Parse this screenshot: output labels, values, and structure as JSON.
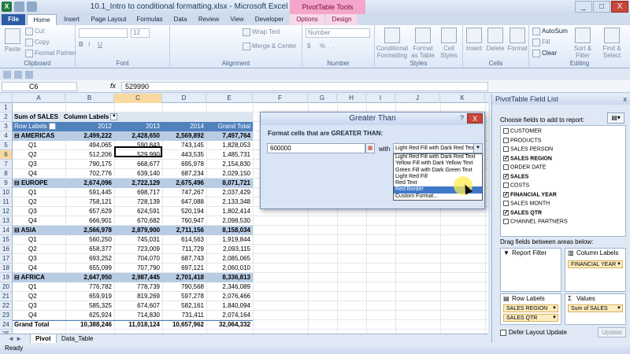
{
  "window": {
    "title": "10.1_Intro to conditional formatting.xlsx - Microsoft Excel",
    "contextual_tab_group": "PivotTable Tools",
    "controls": [
      "_",
      "□",
      "X"
    ]
  },
  "ribbon_tabs": [
    "File",
    "Home",
    "Insert",
    "Page Layout",
    "Formulas",
    "Data",
    "Review",
    "View",
    "Developer",
    "Options",
    "Design"
  ],
  "ribbon": {
    "clipboard": {
      "label": "Clipboard",
      "paste": "Paste",
      "cut": "Cut",
      "copy": "Copy",
      "format_painter": "Format Painter"
    },
    "font": {
      "label": "Font",
      "size": "12",
      "bold": "B",
      "italic": "I",
      "underline": "U"
    },
    "alignment": {
      "label": "Alignment",
      "wrap": "Wrap Text",
      "merge": "Merge & Center"
    },
    "number": {
      "label": "Number",
      "format": "Number",
      "currency": "$",
      "percent": "%",
      "comma": ","
    },
    "styles": {
      "label": "Styles",
      "conditional": "Conditional Formatting",
      "format_table": "Format as Table",
      "cell_styles": "Cell Styles"
    },
    "cells": {
      "label": "Cells",
      "insert": "Insert",
      "delete": "Delete",
      "format": "Format"
    },
    "editing": {
      "label": "Editing",
      "autosum": "AutoSum",
      "fill": "Fill",
      "clear": "Clear",
      "sort": "Sort & Filter",
      "find": "Find & Select"
    }
  },
  "formula_bar": {
    "name_box": "C6",
    "fx": "fx",
    "value": "529990"
  },
  "columns": [
    "A",
    "B",
    "C",
    "D",
    "E",
    "F",
    "G",
    "H",
    "I",
    "J",
    "K"
  ],
  "rows": [
    "1",
    "2",
    "3",
    "4",
    "5",
    "6",
    "7",
    "8",
    "9",
    "10",
    "11",
    "12",
    "13",
    "14",
    "15",
    "16",
    "17",
    "18",
    "19",
    "20",
    "21",
    "22",
    "23",
    "24",
    "25"
  ],
  "pivot": {
    "sum_label": "Sum of SALES",
    "col_labels": "Column Labels",
    "row_labels": "Row Labels",
    "years": [
      "2012",
      "2013",
      "2014",
      "Grand Total"
    ],
    "regions": [
      {
        "name": "AMERICAS",
        "values": [
          "2,499,222",
          "2,428,650",
          "2,569,892",
          "7,497,764"
        ],
        "quarters": [
          {
            "q": "Q1",
            "values": [
              "494,065",
              "590,843",
              "743,145",
              "1,828,053"
            ]
          },
          {
            "q": "Q2",
            "values": [
              "512,206",
              "529,990",
              "443,535",
              "1,485,731"
            ]
          },
          {
            "q": "Q3",
            "values": [
              "790,175",
              "668,677",
              "695,978",
              "2,154,830"
            ]
          },
          {
            "q": "Q4",
            "values": [
              "702,776",
              "639,140",
              "687,234",
              "2,029,150"
            ]
          }
        ]
      },
      {
        "name": "EUROPE",
        "values": [
          "2,674,096",
          "2,722,129",
          "2,675,496",
          "8,071,721"
        ],
        "quarters": [
          {
            "q": "Q1",
            "values": [
              "591,445",
              "698,717",
              "747,267",
              "2,037,429"
            ]
          },
          {
            "q": "Q2",
            "values": [
              "758,121",
              "728,139",
              "647,088",
              "2,133,348"
            ]
          },
          {
            "q": "Q3",
            "values": [
              "657,629",
              "624,591",
              "520,194",
              "1,802,414"
            ]
          },
          {
            "q": "Q4",
            "values": [
              "666,901",
              "670,682",
              "760,947",
              "2,098,530"
            ]
          }
        ]
      },
      {
        "name": "ASIA",
        "values": [
          "2,566,978",
          "2,879,900",
          "2,711,156",
          "8,158,034"
        ],
        "quarters": [
          {
            "q": "Q1",
            "values": [
              "560,250",
              "745,031",
              "614,563",
              "1,919,844"
            ]
          },
          {
            "q": "Q2",
            "values": [
              "658,377",
              "723,009",
              "711,729",
              "2,093,115"
            ]
          },
          {
            "q": "Q3",
            "values": [
              "693,252",
              "704,070",
              "687,743",
              "2,085,065"
            ]
          },
          {
            "q": "Q4",
            "values": [
              "655,099",
              "707,790",
              "697,121",
              "2,060,010"
            ]
          }
        ]
      },
      {
        "name": "AFRICA",
        "values": [
          "2,647,950",
          "2,987,445",
          "2,701,418",
          "8,336,813"
        ],
        "quarters": [
          {
            "q": "Q1",
            "values": [
              "776,782",
              "778,739",
              "790,568",
              "2,346,089"
            ]
          },
          {
            "q": "Q2",
            "values": [
              "659,919",
              "819,269",
              "597,278",
              "2,076,466"
            ]
          },
          {
            "q": "Q3",
            "values": [
              "585,325",
              "674,607",
              "582,161",
              "1,840,094"
            ]
          },
          {
            "q": "Q4",
            "values": [
              "625,924",
              "714,830",
              "731,411",
              "2,074,164"
            ]
          }
        ]
      }
    ],
    "grand_total": {
      "label": "Grand Total",
      "values": [
        "10,388,246",
        "11,018,124",
        "10,657,962",
        "32,064,332"
      ]
    }
  },
  "sheet_tabs": [
    "Pivot",
    "Data_Table"
  ],
  "status": {
    "ready": "Ready"
  },
  "dialog": {
    "title": "Greater Than",
    "help": "?",
    "close": "X",
    "prompt": "Format cells that are GREATER THAN:",
    "input_value": "600000",
    "with_label": "with",
    "selected": "Light Red Fill with Dark Red Text",
    "options": [
      "Light Red Fill with Dark Red Text",
      "Yellow Fill with Dark Yellow Text",
      "Green Fill with Dark Green Text",
      "Light Red Fill",
      "Red Text",
      "Red Border",
      "Custom Format..."
    ],
    "highlighted_option": "Red Border"
  },
  "field_list": {
    "title": "PivotTable Field List",
    "close": "x",
    "choose_label": "Choose fields to add to report:",
    "fields": [
      {
        "name": "CUSTOMER",
        "checked": false
      },
      {
        "name": "PRODUCTS",
        "checked": false
      },
      {
        "name": "SALES PERSON",
        "checked": false
      },
      {
        "name": "SALES REGION",
        "checked": true
      },
      {
        "name": "ORDER DATE",
        "checked": false
      },
      {
        "name": "SALES",
        "checked": true
      },
      {
        "name": "COSTS",
        "checked": false
      },
      {
        "name": "FINANCIAL YEAR",
        "checked": true
      },
      {
        "name": "SALES MONTH",
        "checked": false
      },
      {
        "name": "SALES QTR",
        "checked": true
      },
      {
        "name": "CHANNEL PARTNERS",
        "checked": false
      }
    ],
    "drag_label": "Drag fields between areas below:",
    "report_filter": "Report Filter",
    "column_labels": "Column Labels",
    "row_labels": "Row Labels",
    "values": "Values",
    "column_chip": "FINANCIAL YEAR",
    "row_chips": [
      "SALES REGION",
      "SALES QTR"
    ],
    "values_chip": "Sum of SALES",
    "defer_label": "Defer Layout Update",
    "update": "Update"
  }
}
